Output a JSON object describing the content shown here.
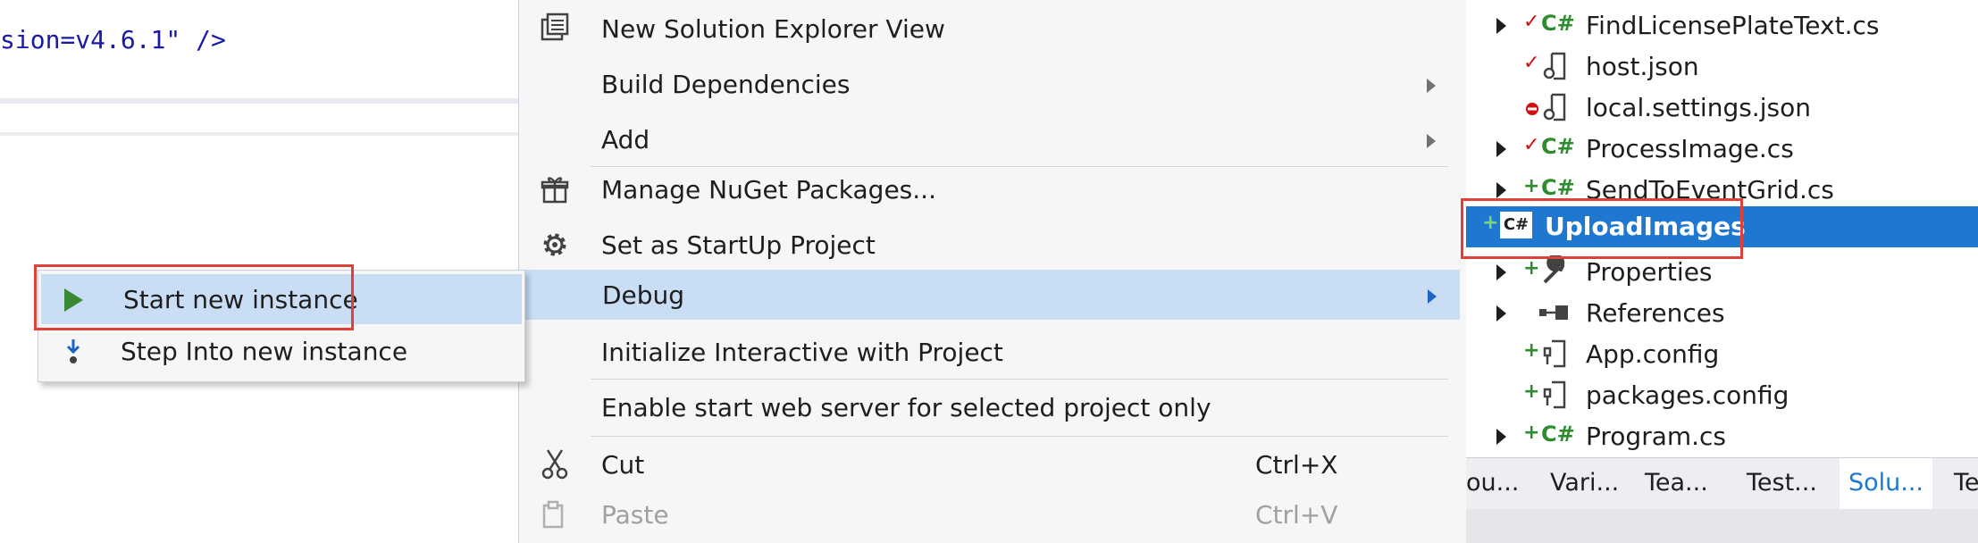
{
  "editor": {
    "code_line": "sion=v4.6.1\" />"
  },
  "debug_submenu": {
    "items": [
      {
        "label": "Start new instance",
        "icon": "play-icon",
        "highlighted": true
      },
      {
        "label": "Step Into new instance",
        "icon": "step-into-icon",
        "highlighted": false
      }
    ]
  },
  "context_menu": {
    "items": [
      {
        "label": "New Solution Explorer View",
        "icon": "new-view-icon"
      },
      {
        "label": "Build Dependencies",
        "submenu": true
      },
      {
        "label": "Add",
        "submenu": true
      },
      {
        "label": "Manage NuGet Packages...",
        "icon": "nuget-gift-icon"
      },
      {
        "label": "Set as StartUp Project",
        "icon": "gear-icon"
      },
      {
        "label": "Debug",
        "submenu": true,
        "highlighted": true
      },
      {
        "label": "Initialize Interactive with Project"
      },
      {
        "label": "Enable start web server for selected project only"
      },
      {
        "label": "Cut",
        "shortcut": "Ctrl+X",
        "icon": "scissors-icon"
      },
      {
        "label": "Paste",
        "shortcut": "Ctrl+V",
        "icon": "paste-icon",
        "disabled": true
      }
    ]
  },
  "solution_explorer": {
    "nodes": [
      {
        "label": "FindLicensePlateText.cs",
        "status": "checked-in",
        "type": "csharp-file"
      },
      {
        "label": "host.json",
        "status": "checked-in",
        "type": "json-file"
      },
      {
        "label": "local.settings.json",
        "status": "excluded",
        "type": "json-file"
      },
      {
        "label": "ProcessImage.cs",
        "status": "checked-in",
        "type": "csharp-file"
      },
      {
        "label": "SendToEventGrid.cs",
        "status": "added",
        "type": "csharp-file"
      },
      {
        "label": "UploadImages",
        "status": "added",
        "type": "csharp-project",
        "selected": true
      },
      {
        "label": "Properties",
        "status": "added",
        "type": "properties"
      },
      {
        "label": "References",
        "status": "none",
        "type": "references"
      },
      {
        "label": "App.config",
        "status": "added",
        "type": "config-file"
      },
      {
        "label": "packages.config",
        "status": "added",
        "type": "config-file"
      },
      {
        "label": "Program.cs",
        "status": "added",
        "type": "csharp-file"
      }
    ],
    "tabs": [
      {
        "label": "ou..."
      },
      {
        "label": "Vari..."
      },
      {
        "label": "Tea..."
      },
      {
        "label": "Test..."
      },
      {
        "label": "Solu...",
        "active": true
      },
      {
        "label": "Te"
      }
    ]
  },
  "colors": {
    "menu_bg": "#f6f6f6",
    "highlight": "#c9def5",
    "selection": "#1e78d0",
    "callout": "#e0403a",
    "checkmark": "#d01010",
    "added": "#2e8b2e",
    "csharp": "#2e8b2e"
  }
}
